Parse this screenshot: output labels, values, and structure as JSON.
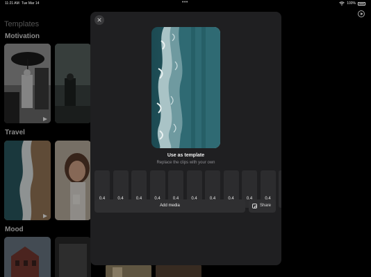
{
  "status_bar": {
    "time": "11:21 AM",
    "date": "Tue Mar 14",
    "battery": "100%"
  },
  "background": {
    "title": "Templates",
    "sections": [
      {
        "title": "Motivation"
      },
      {
        "title": "Travel"
      },
      {
        "title": "Mood"
      }
    ]
  },
  "sheet": {
    "title": "Use as template",
    "subtitle": "Replace the clips with your own",
    "clips": [
      "0.4",
      "0.4",
      "0.4",
      "0.4",
      "0.4",
      "0.4",
      "0.4",
      "0.4",
      "0.4",
      "0.4"
    ],
    "add_media_label": "Add media",
    "share_label": "Share"
  }
}
